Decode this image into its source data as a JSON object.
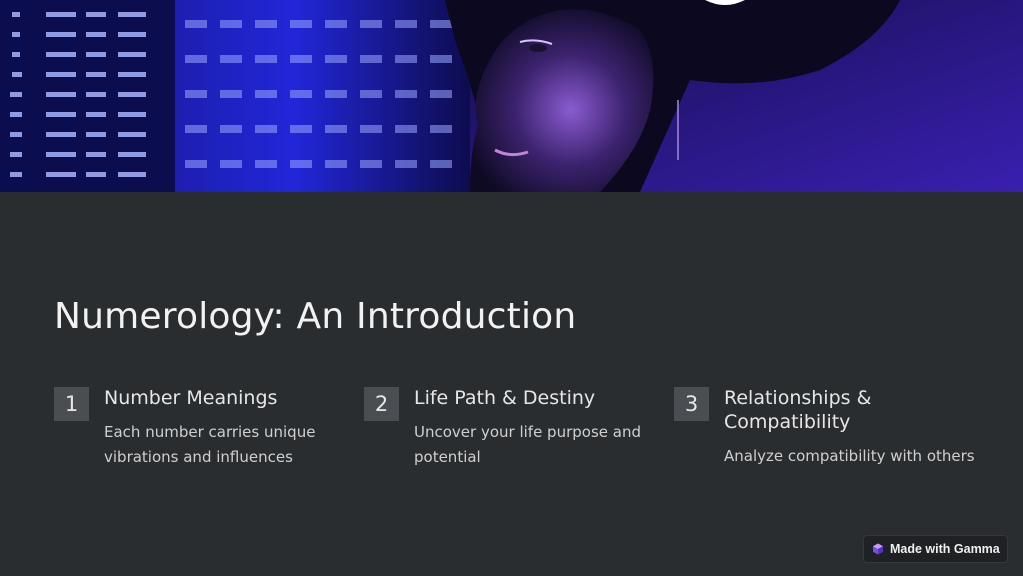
{
  "title": "Numerology: An Introduction",
  "hero": {
    "image_description_icon": "woman-viewing-data-screen-image"
  },
  "items": [
    {
      "number": "1",
      "title": "Number Meanings",
      "description": "Each number carries unique vibrations and influences"
    },
    {
      "number": "2",
      "title": "Life Path & Destiny",
      "description": "Uncover your life purpose and potential"
    },
    {
      "number": "3",
      "title": "Relationships & Compatibility",
      "description": "Analyze compatibility with others"
    }
  ],
  "made_with": {
    "label": "Made with Gamma",
    "icon": "gamma-logo-icon"
  },
  "colors": {
    "background": "#2a2d30",
    "badge": "#4a4d51",
    "title_text": "#f2f2f2",
    "accent_purple": "#6a3bd6"
  }
}
